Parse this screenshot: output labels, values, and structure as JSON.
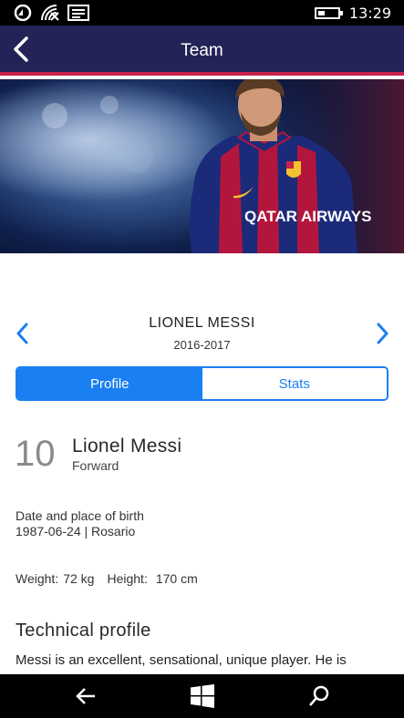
{
  "status_bar": {
    "time": "13:29",
    "battery_level": 0.35,
    "icons": [
      "notification-icon",
      "wifi-icon",
      "message-icon",
      "battery-icon"
    ]
  },
  "header": {
    "title": "Team",
    "back_icon": "chevron-left-icon",
    "background_color": "#242357",
    "accent_color": "#c8224a"
  },
  "player": {
    "name_caps": "LIONEL MESSI",
    "season": "2016-2017",
    "number": "10",
    "full_name": "Lionel Messi",
    "position": "Forward"
  },
  "tabs": [
    {
      "label": "Profile",
      "active": true
    },
    {
      "label": "Stats",
      "active": false
    }
  ],
  "profile": {
    "birth_label": "Date and place of birth",
    "birth_value": "1987-06-24 | Rosario",
    "weight_label": "Weight:",
    "weight_value": "72 kg",
    "height_label": "Height:",
    "height_value": "170 cm",
    "technical_title": "Technical profile",
    "bio": "Messi is an excellent, sensational, unique player. He is"
  },
  "hero_image": {
    "shirt_sponsor": "QATAR AIRWAYS"
  },
  "colors": {
    "accent_blue": "#1a7ff0"
  }
}
